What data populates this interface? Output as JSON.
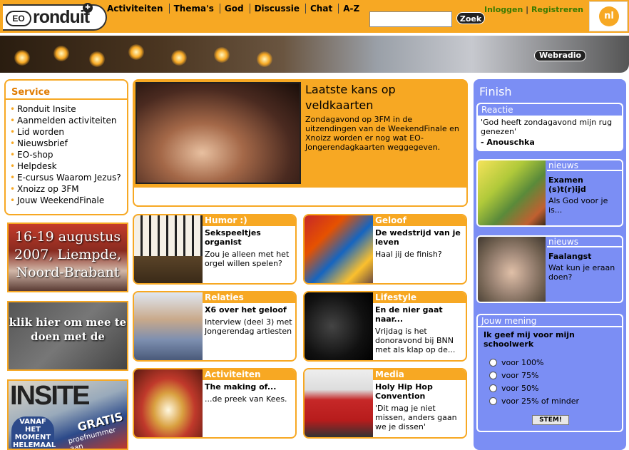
{
  "header": {
    "logo_eo": "EO",
    "logo_text": "ronduit",
    "nav": [
      "Activiteiten",
      "Thema's",
      "God",
      "Discussie",
      "Chat",
      "A-Z"
    ],
    "search_button": "Zoek",
    "login": "Inloggen",
    "separator": "|",
    "register": "Registreren",
    "nl_logo": "nl"
  },
  "banner": {
    "webradio": "Webradio"
  },
  "service": {
    "title": "Service",
    "items": [
      "Ronduit Insite",
      "Aanmelden activiteiten",
      "Lid worden",
      "Nieuwsbrief",
      "EO-shop",
      "Helpdesk",
      "E-cursus Waarom Jezus?",
      "Xnoizz op 3FM",
      "Jouw WeekendFinale"
    ]
  },
  "promos": {
    "p1": "16-19 augustus 2007, Liempde, Noord-Brabant",
    "p2": "klik hier om mee te doen met de",
    "p3_title": "INSITE",
    "p3_badge": "VANAF HET MOMENT HELEMAAL NIEUW",
    "p3_gratis": "GRATIS",
    "p3_sub": "proefnummer aan"
  },
  "feature": {
    "title": "Laatste kans op veldkaarten",
    "text": "Zondagavond op 3FM in de uitzendingen van de WeekendFinale en Xnoizz worden er nog wat EO-Jongerendagkaarten weggegeven."
  },
  "cards": [
    {
      "header": "Humor :)",
      "title": "Sekspeeltjes organist",
      "text": "Zou je alleen met het orgel willen spelen?"
    },
    {
      "header": "Geloof",
      "title": "De wedstrijd van je leven",
      "text": "Haal jij de finish?"
    },
    {
      "header": "Relaties",
      "title": "X6 over het geloof",
      "text": "Interview (deel 3) met Jongerendag artiesten"
    },
    {
      "header": "Lifestyle",
      "title": "En de nier gaat naar...",
      "text": "Vrijdag is het donoravond bij BNN met als klap op de..."
    },
    {
      "header": "Activiteiten",
      "title": "The making of...",
      "text": "...de preek van Kees."
    },
    {
      "header": "Media",
      "title": "Holy Hip Hop Convention",
      "text": "'Dit mag je niet missen, anders gaan we je dissen'"
    }
  ],
  "right": {
    "title": "Finish",
    "reactie": {
      "header": "Reactie",
      "quote": "'God heeft zondagavond mijn rug genezen'",
      "author": "- Anouschka"
    },
    "news": [
      {
        "header": "nieuws",
        "title": "Examen (s)t(r)ijd",
        "text": "Als God voor je is..."
      },
      {
        "header": "nieuws",
        "title": "Faalangst",
        "text": "Wat kun je eraan doen?"
      }
    ],
    "poll": {
      "header": "Jouw mening",
      "question": "Ik geef mij voor mijn schoolwerk",
      "options": [
        "voor 100%",
        "voor 75%",
        "voor 50%",
        "voor 25% of minder"
      ],
      "submit": "STEM!"
    }
  }
}
